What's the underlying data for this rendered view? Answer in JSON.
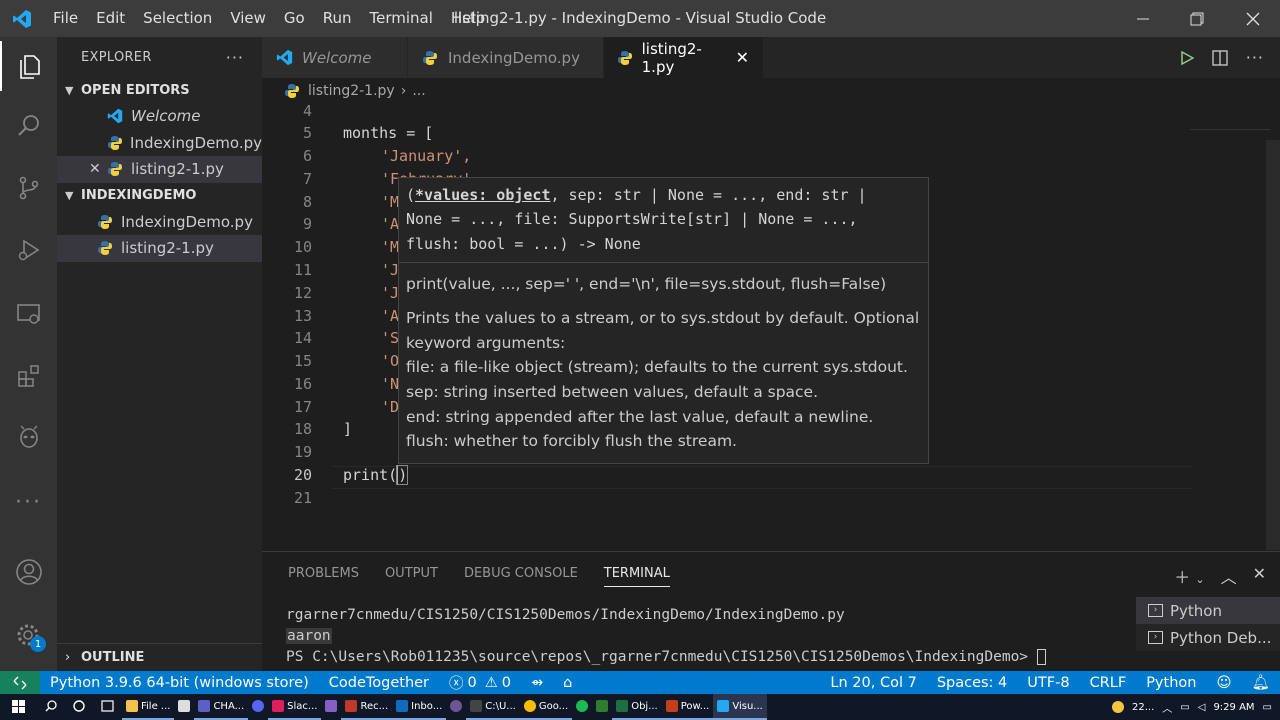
{
  "colors": {
    "accent": "#007acc",
    "remote": "#16825d",
    "python_yellow": "#f4d03f",
    "python_blue": "#3572a5",
    "vscode_blue": "#23a9f2",
    "string": "#ce9178"
  },
  "titlebar": {
    "menus": [
      "File",
      "Edit",
      "Selection",
      "View",
      "Go",
      "Run",
      "Terminal",
      "Help"
    ],
    "title": "listing2-1.py - IndexingDemo - Visual Studio Code"
  },
  "sidebar": {
    "header": "EXPLORER",
    "open_editors": {
      "title": "OPEN EDITORS",
      "items": [
        "Welcome",
        "IndexingDemo.py",
        "listing2-1.py"
      ]
    },
    "folder": {
      "title": "INDEXINGDEMO",
      "items": [
        "IndexingDemo.py",
        "listing2-1.py"
      ]
    },
    "outline": "OUTLINE"
  },
  "tabs": [
    "Welcome",
    "IndexingDemo.py",
    "listing2-1.py"
  ],
  "breadcrumb": {
    "file": "listing2-1.py",
    "more": "..."
  },
  "editor": {
    "line_numbers": [
      "4",
      "5",
      "6",
      "7",
      "8",
      "9",
      "10",
      "11",
      "12",
      "13",
      "14",
      "15",
      "16",
      "17",
      "18",
      "19",
      "20",
      "21"
    ],
    "code": {
      "l5": "months = [",
      "l6": "'January',",
      "l7": "'February',",
      "l8": "'M",
      "l9": "'A",
      "l10": "'M",
      "l11": "'J",
      "l12": "'J",
      "l13": "'A",
      "l14": "'S",
      "l15": "'O",
      "l16": "'N",
      "l17": "'D",
      "l18": "]",
      "l20a": "print(",
      "l20b": ")"
    }
  },
  "hover": {
    "sig1_bold": "*values: object",
    "sig1_open": "(",
    "sig1_rest": ", sep: str | None = ..., end: str |",
    "sig2": "None = ..., file: SupportsWrite[str] | None = ...,",
    "sig3": "flush: bool = ...) -> None",
    "usage": "print(value, ..., sep=' ', end='\\n', file=sys.stdout, flush=False)",
    "doc": [
      "Prints the values to a stream, or to sys.stdout by default. Optional",
      "keyword arguments:",
      "file: a file-like object (stream); defaults to the current sys.stdout.",
      "sep: string inserted between values, default a space.",
      "end: string appended after the last value, default a newline.",
      "flush: whether to forcibly flush the stream."
    ]
  },
  "panel": {
    "tabs": [
      "PROBLEMS",
      "OUTPUT",
      "DEBUG CONSOLE",
      "TERMINAL"
    ],
    "terminal_lines": [
      "rgarner7cnmedu/CIS1250/CIS1250Demos/IndexingDemo/IndexingDemo.py",
      "aaron",
      "PS C:\\Users\\Rob011235\\source\\repos\\_rgarner7cnmedu\\CIS1250\\CIS1250Demos\\IndexingDemo>"
    ],
    "terminals": [
      "Python",
      "Python Deb..."
    ]
  },
  "statusbar": {
    "interpreter": "Python 3.9.6 64-bit (windows store)",
    "codetogether": "CodeTogether",
    "errors": "0",
    "warnings": "0",
    "position": "Ln 20, Col 7",
    "spaces": "Spaces: 4",
    "encoding": "UTF-8",
    "eol": "CRLF",
    "language": "Python"
  },
  "activity": {
    "badge": "1"
  },
  "taskbar": {
    "apps": [
      "File ...",
      "CHA...",
      "Slac...",
      "Rec...",
      "Inbo...",
      "C:\\U...",
      "Goo...",
      "Obj...",
      "Pow...",
      "Visu..."
    ],
    "weather": "22...",
    "time": "9:29 AM"
  }
}
